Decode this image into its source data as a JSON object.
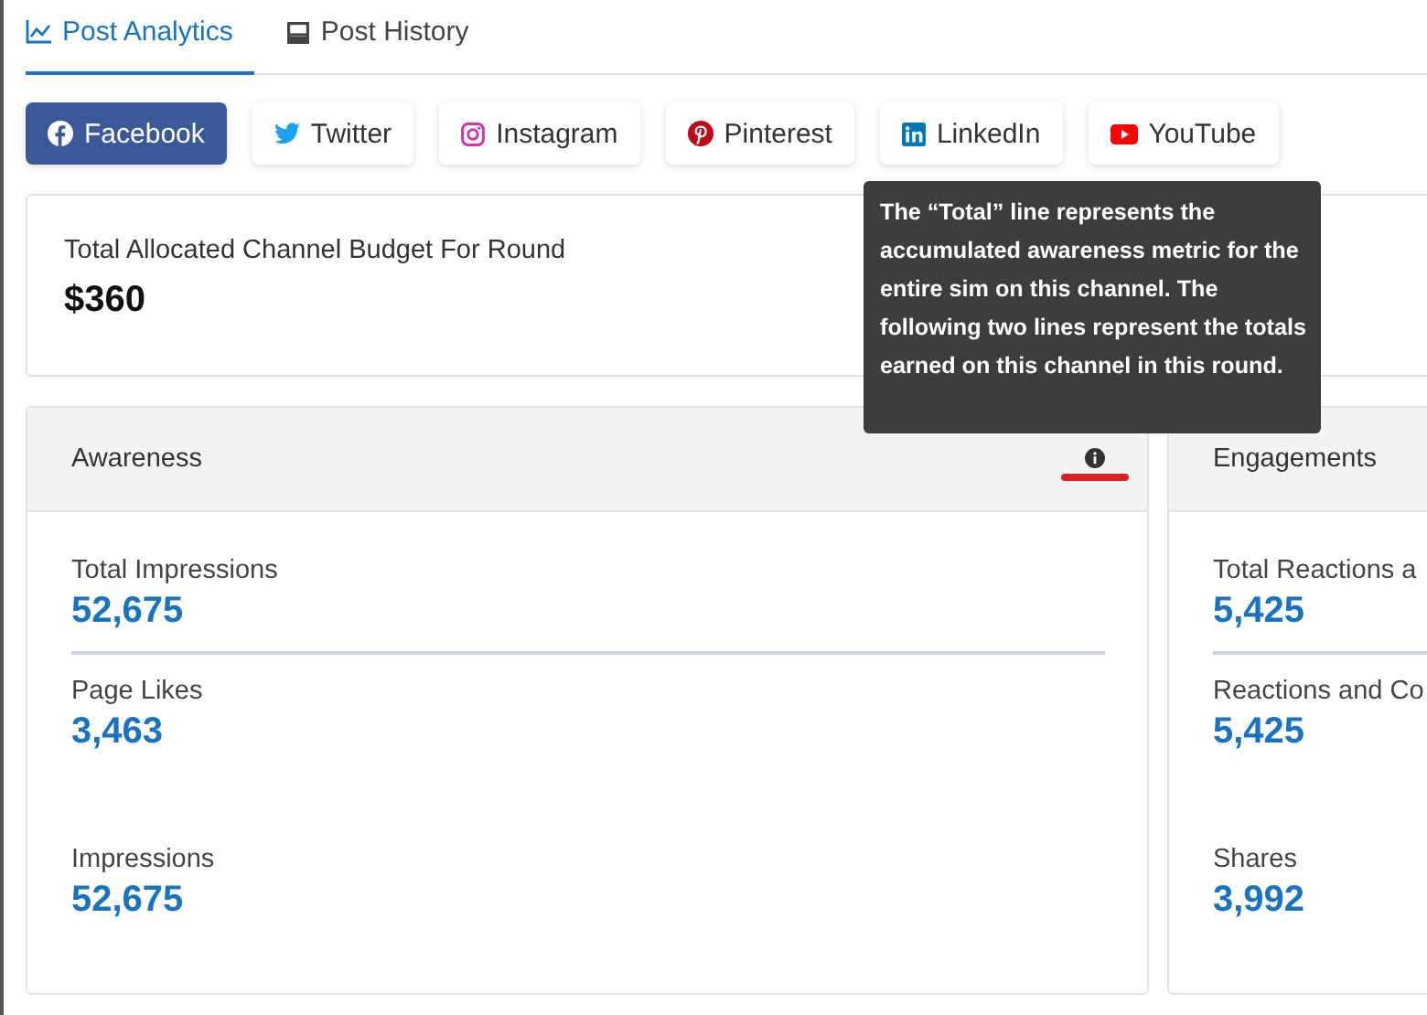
{
  "tabs": [
    {
      "label": "Post Analytics",
      "kind": "chart",
      "selected": true
    },
    {
      "label": "Post History",
      "kind": "history",
      "selected": false
    }
  ],
  "channels": [
    {
      "label": "Facebook",
      "kind": "facebook",
      "selected": true
    },
    {
      "label": "Twitter",
      "kind": "twitter",
      "selected": false
    },
    {
      "label": "Instagram",
      "kind": "instagram",
      "selected": false
    },
    {
      "label": "Pinterest",
      "kind": "pinterest",
      "selected": false
    },
    {
      "label": "LinkedIn",
      "kind": "linkedin",
      "selected": false
    },
    {
      "label": "YouTube",
      "kind": "youtube",
      "selected": false
    }
  ],
  "budget": {
    "label": "Total Allocated Channel Budget For Round",
    "value": "$360"
  },
  "panels": [
    {
      "title": "Awareness",
      "info": true,
      "total": {
        "label": "Total Impressions",
        "value": "52,675"
      },
      "round": [
        {
          "label": "Page Likes",
          "value": "3,463"
        },
        {
          "label": "Impressions",
          "value": "52,675"
        }
      ]
    },
    {
      "title": "Engagements",
      "info": false,
      "total": {
        "label": "Total Reactions a",
        "value": "5,425"
      },
      "round": [
        {
          "label": "Reactions and Co",
          "value": "5,425"
        },
        {
          "label": "Shares",
          "value": "3,992"
        }
      ]
    }
  ],
  "tooltip": {
    "text": "The “Total” line represents the accumulated awareness metric for the entire sim on this channel. The following two lines represent the totals earned on this channel in this round."
  }
}
